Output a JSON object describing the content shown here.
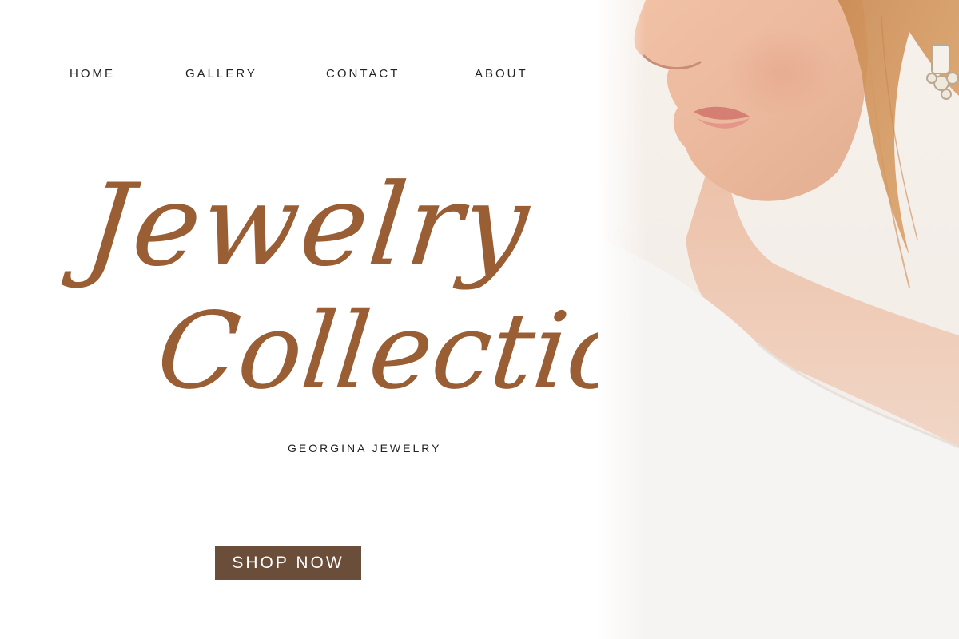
{
  "nav": {
    "items": [
      {
        "label": "HOME",
        "active": true
      },
      {
        "label": "GALLERY",
        "active": false
      },
      {
        "label": "CONTACT",
        "active": false
      },
      {
        "label": "ABOUT",
        "active": false
      }
    ]
  },
  "hero": {
    "title_line_1": "Jewelry",
    "title_line_2": "Collection",
    "brand": "GEORGINA JEWELRY",
    "cta_label": "SHOP NOW"
  },
  "colors": {
    "title": "#9a5e34",
    "button": "#6a4e3a",
    "text": "#222222",
    "background": "#ffffff"
  },
  "photo": {
    "subject": "woman-with-crystal-earring"
  }
}
